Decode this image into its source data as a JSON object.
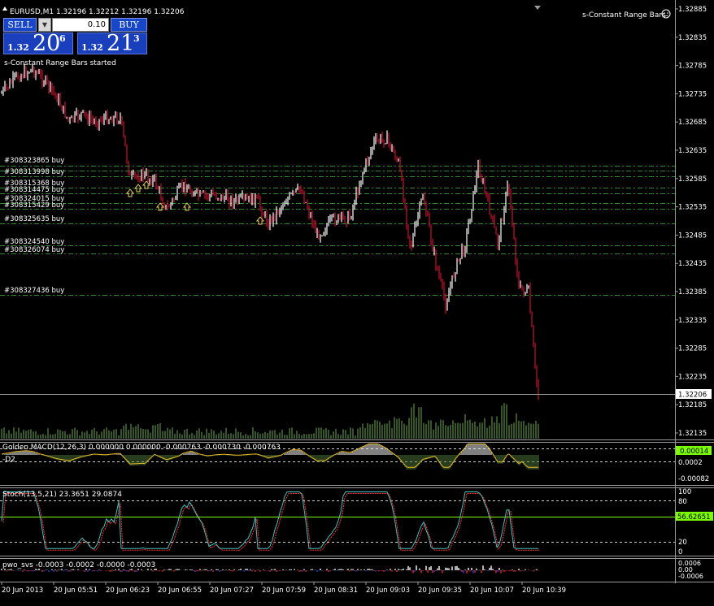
{
  "header": {
    "symbol_line": "EURUSD,M1  1.32196  1.32212  1.32196  1.32206",
    "indicator_name": "s-Constant Range Bars",
    "status_message": "s-Constant Range Bars started"
  },
  "trade_panel": {
    "sell_label": "SELL",
    "buy_label": "BUY",
    "lot_value": "0.10",
    "sell_prefix": "1.32",
    "sell_big": "20",
    "sell_sup": "6",
    "buy_prefix": "1.32",
    "buy_big": "21",
    "buy_sup": "3"
  },
  "price_axis": {
    "labels": [
      "1.32885",
      "1.32835",
      "1.32785",
      "1.32735",
      "1.32685",
      "1.32635",
      "1.32585",
      "1.32535",
      "1.32485",
      "1.32435",
      "1.32385",
      "1.32335",
      "1.32285",
      "1.32235",
      "1.32185",
      "1.32135"
    ],
    "current_price": "1.32206"
  },
  "orders": [
    {
      "label": "#308323865 buy"
    },
    {
      "label": "#308313998 buy"
    },
    {
      "label": "#308315368 buy"
    },
    {
      "label": "#308314475 buy"
    },
    {
      "label": "#308324015 buy"
    },
    {
      "label": "#308315429 buy"
    },
    {
      "label": "#308325635 buy"
    },
    {
      "label": "#308324540 buy"
    },
    {
      "label": "#308326074 buy"
    },
    {
      "label": "#308327436 buy"
    }
  ],
  "macd": {
    "title": "Golden MACD(12,26,3) 0.000000 0.000000 -0.000763 -0.000730 -0.000763",
    "sub_label": "-D2",
    "current_value": "0.00014",
    "axis_labels": [
      "0.0002",
      "-0.00082"
    ]
  },
  "stoch": {
    "title": "Stoch(13,5,21) 23.3651 29.0874",
    "current_value": "56.62651",
    "axis_labels": [
      "100",
      "80",
      "20",
      "0"
    ]
  },
  "pwo": {
    "title": "pwo_svs -0.0003 -0.0002 -0.0000 -0.0003",
    "axis_labels": [
      "0.0006",
      "0.00",
      "-0.0006"
    ]
  },
  "time_axis": {
    "labels": [
      "20 Jun 2013",
      "20 Jun 05:51",
      "20 Jun 06:23",
      "20 Jun 06:55",
      "20 Jun 07:27",
      "20 Jun 07:59",
      "20 Jun 08:31",
      "20 Jun 09:03",
      "20 Jun 09:35",
      "20 Jun 10:07",
      "20 Jun 10:39"
    ]
  },
  "colors": {
    "background": "#000000",
    "bull_bar": "#ffffff",
    "bear_bar": "#c8102e",
    "volume": "#4e7a3a",
    "order_line": "#2e8b2e",
    "arrow": "#f0d060",
    "macd_signal": "#e8b820",
    "stoch_main": "#40c0c0",
    "stoch_signal": "#ff3030",
    "level_line": "#7cfc00"
  }
}
